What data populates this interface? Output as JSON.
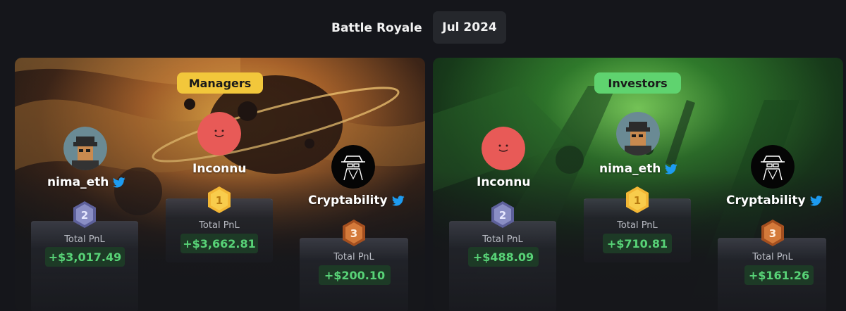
{
  "header": {
    "title": "Battle Royale",
    "month": "Jul 2024"
  },
  "managers": {
    "label": "Managers",
    "pill_color": "#f2c73b",
    "first": {
      "name": "Inconnu",
      "rank": "1",
      "pnl_label": "Total PnL",
      "pnl": "+$3,662.81"
    },
    "second": {
      "name": "nima_eth",
      "rank": "2",
      "pnl_label": "Total PnL",
      "pnl": "+$3,017.49"
    },
    "third": {
      "name": "Cryptability",
      "rank": "3",
      "pnl_label": "Total PnL",
      "pnl": "+$200.10"
    }
  },
  "investors": {
    "label": "Investors",
    "pill_color": "#5fd36f",
    "first": {
      "name": "nima_eth",
      "rank": "1",
      "pnl_label": "Total PnL",
      "pnl": "+$710.81"
    },
    "second": {
      "name": "Inconnu",
      "rank": "2",
      "pnl_label": "Total PnL",
      "pnl": "+$488.09"
    },
    "third": {
      "name": "Cryptability",
      "rank": "3",
      "pnl_label": "Total PnL",
      "pnl": "+$161.26"
    }
  },
  "icons": {
    "social": "twitter-icon",
    "medal_gold": "#f3b735",
    "medal_silver": "#7c7fb4",
    "medal_bronze": "#c8692d",
    "pnl_green": "#58d377"
  }
}
